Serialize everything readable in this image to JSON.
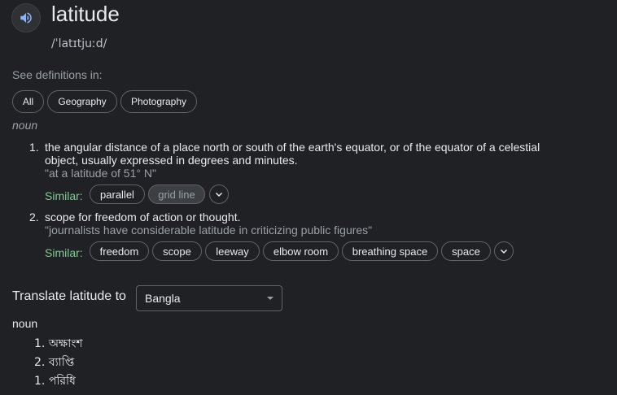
{
  "headword": "latitude",
  "phonetic": "/ˈlatɪtjuːd/",
  "see_definitions": {
    "label": "See definitions in:",
    "chips": [
      "All",
      "Geography",
      "Photography"
    ]
  },
  "part_of_speech": "noun",
  "senses": [
    {
      "number": "1.",
      "definition_line1": "the angular distance of a place north or south of the earth's equator, or of the equator of a celestial",
      "definition_line2": "object, usually expressed in degrees and minutes.",
      "example": "\"at a latitude of 51° N\"",
      "similar_label": "Similar:",
      "similar": [
        "parallel",
        "grid line"
      ]
    },
    {
      "number": "2.",
      "definition_line1": "scope for freedom of action or thought.",
      "example": "\"journalists have considerable latitude in criticizing public figures\"",
      "similar_label": "Similar:",
      "similar": [
        "freedom",
        "scope",
        "leeway",
        "elbow room",
        "breathing space",
        "space"
      ]
    }
  ],
  "translate": {
    "label": "Translate latitude to",
    "language": "Bangla",
    "part_of_speech": "noun",
    "items": [
      {
        "number": "1.",
        "text": "অক্ষাংশ"
      },
      {
        "number": "2.",
        "text": "ব্যাপ্তি"
      },
      {
        "number": "1.",
        "text": "পরিধি"
      }
    ]
  },
  "icons": {
    "speaker": "speaker-icon",
    "expand": "chevron-down-icon",
    "dropdown": "dropdown-caret-icon"
  },
  "colors": {
    "background": "#202124",
    "text": "#e8eaed",
    "muted": "#9aa0a6",
    "similar_label": "#81c995",
    "speaker_icon": "#8ab4f8"
  }
}
